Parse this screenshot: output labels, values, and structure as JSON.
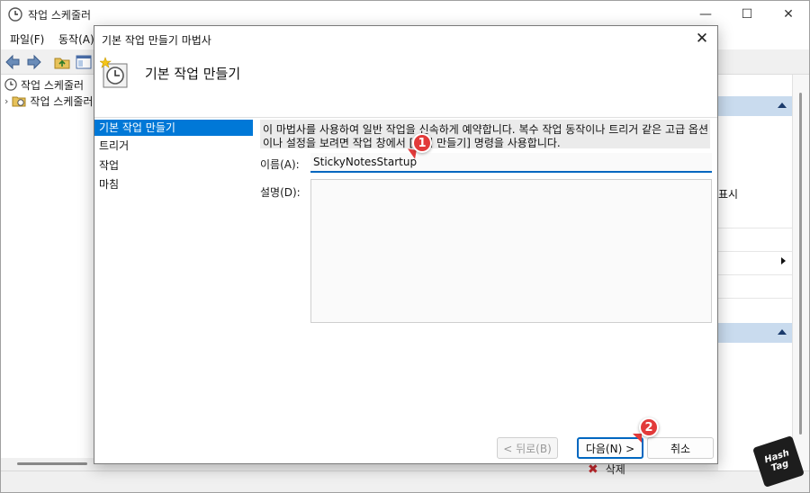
{
  "main_window": {
    "title": "작업 스케줄러",
    "menu": [
      "파일(F)",
      "동작(A)"
    ],
    "tree": [
      {
        "label": "작업 스케줄러"
      },
      {
        "label": "작업 스케줄러"
      }
    ],
    "actions_pane": {
      "visible_text": "표시"
    },
    "status_item": "삭제"
  },
  "dialog": {
    "title": "기본 작업 만들기 마법사",
    "heading": "기본 작업 만들기",
    "nav_items": [
      "기본 작업 만들기",
      "트리거",
      "작업",
      "마침"
    ],
    "active_nav_index": 0,
    "intro": "이 마법사를 사용하여 일반 작업을 신속하게 예약합니다. 복수 작업 동작이나 트리거 같은 고급 옵션이나 설정을 보려면 작업 창에서 [작업 만들기] 명령을 사용합니다.",
    "name_label": "이름(A):",
    "name_value": "StickyNotesStartup",
    "description_label": "설명(D):",
    "description_value": "",
    "buttons": {
      "back": "< 뒤로(B)",
      "next": "다음(N) >",
      "cancel": "취소"
    }
  },
  "annotations": {
    "badge1": "1",
    "badge2": "2"
  },
  "watermark": {
    "line1": "Hash",
    "line2": "Tag"
  },
  "colors": {
    "accent": "#0078d7",
    "focus": "#0067c0",
    "badge": "#e23a3a"
  }
}
